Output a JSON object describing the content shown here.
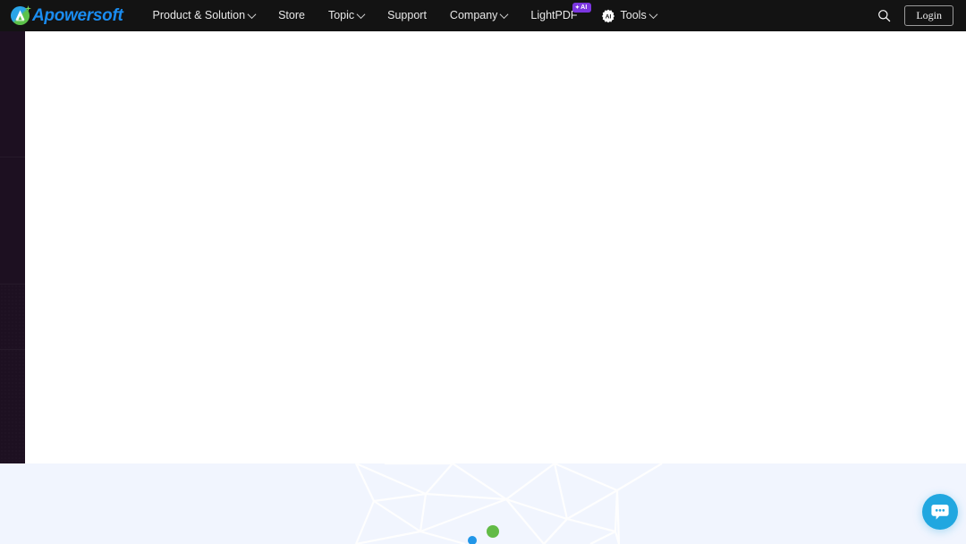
{
  "header": {
    "background_color": "#131313",
    "logo": {
      "name": "Apowersoft",
      "icon": "apowersoft-logo-icon",
      "text_color": "#1a8cf0"
    },
    "nav_items": [
      {
        "label": "Product & Solution",
        "has_dropdown": true,
        "icon": "chevron-down-icon"
      },
      {
        "label": "Store",
        "has_dropdown": false,
        "icon": ""
      },
      {
        "label": "Topic",
        "has_dropdown": true,
        "icon": "chevron-down-icon"
      },
      {
        "label": "Support",
        "has_dropdown": false,
        "icon": ""
      },
      {
        "label": "Company",
        "has_dropdown": true,
        "icon": "chevron-down-icon"
      }
    ],
    "lightpdf": {
      "label": "LightPDF",
      "badge_text": "AI",
      "badge_spark": "✦",
      "badge_color": "#7b36e0"
    },
    "tools": {
      "label": "Tools",
      "icon": "ai-tools-icon",
      "icon_text": "AI",
      "has_dropdown": true
    },
    "search": {
      "icon": "search-icon",
      "label": "Search"
    },
    "login": {
      "label": "Login"
    }
  },
  "left_rail": {
    "color": "#1d1021",
    "label": "left-sidebar-strip"
  },
  "main": {
    "background_color": "#ffffff",
    "content": ""
  },
  "hero": {
    "background_color": "#f1f5fe",
    "pattern": "polygon-network-pattern",
    "accent_dots": [
      {
        "name": "green-dot",
        "color": "#62bb46",
        "size": 14
      },
      {
        "name": "blue-dot",
        "color": "#2196e8",
        "size": 10
      }
    ]
  },
  "chat_widget": {
    "icon": "chat-bubble-icon",
    "color": "#21a7e0",
    "label": "Live chat"
  }
}
